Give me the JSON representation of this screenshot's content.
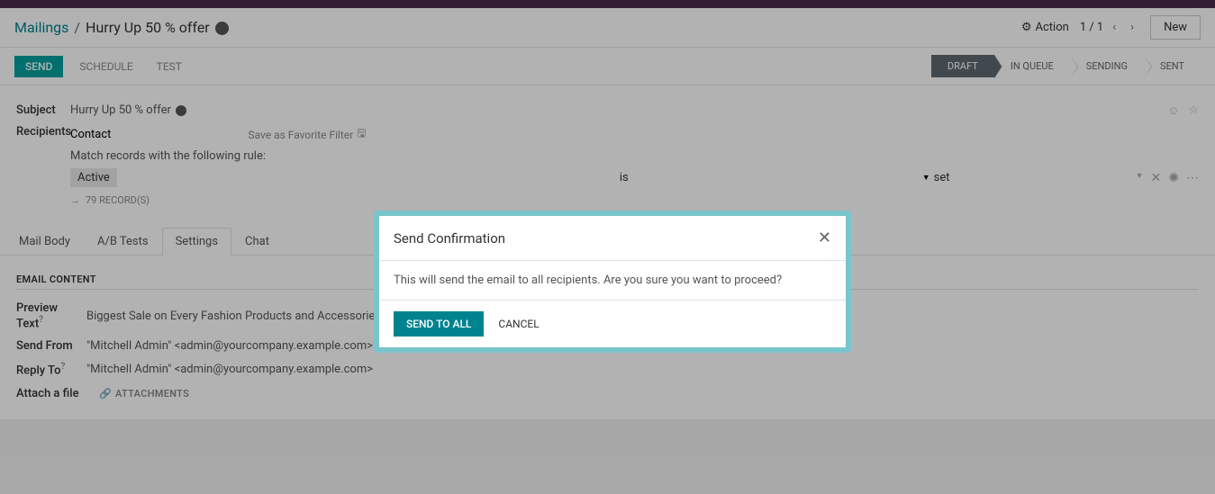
{
  "breadcrumb": {
    "root": "Mailings",
    "current": "Hurry Up 50 % offer"
  },
  "header": {
    "action_label": "Action",
    "pager": "1 / 1",
    "new_label": "New"
  },
  "action_buttons": {
    "send": "SEND",
    "schedule": "SCHEDULE",
    "test": "TEST"
  },
  "status_steps": [
    "DRAFT",
    "IN QUEUE",
    "SENDING",
    "SENT"
  ],
  "form": {
    "subject_label": "Subject",
    "subject_value": "Hurry Up 50 % offer",
    "recipients_label": "Recipients",
    "recipients_type": "Contact",
    "save_filter_label": "Save as Favorite Filter",
    "match_text": "Match records with the following rule:",
    "rule_field": "Active",
    "rule_op": "is",
    "rule_value": "set",
    "records_count": "79 RECORD(S)"
  },
  "tabs": [
    "Mail Body",
    "A/B Tests",
    "Settings",
    "Chat"
  ],
  "email_content": {
    "section_title": "EMAIL CONTENT",
    "preview_label": "Preview Text",
    "preview_value": "Biggest Sale on Every Fashion Products and Accessories.",
    "send_from_label": "Send From",
    "send_from_value": "\"Mitchell Admin\" <admin@yourcompany.example.com>",
    "reply_to_label": "Reply To",
    "reply_to_value": "\"Mitchell Admin\" <admin@yourcompany.example.com>",
    "attach_label": "Attach a file",
    "attachments_link": "ATTACHMENTS"
  },
  "modal": {
    "title": "Send Confirmation",
    "body": "This will send the email to all recipients. Are you sure you want to proceed?",
    "primary": "SEND TO ALL",
    "secondary": "CANCEL"
  }
}
